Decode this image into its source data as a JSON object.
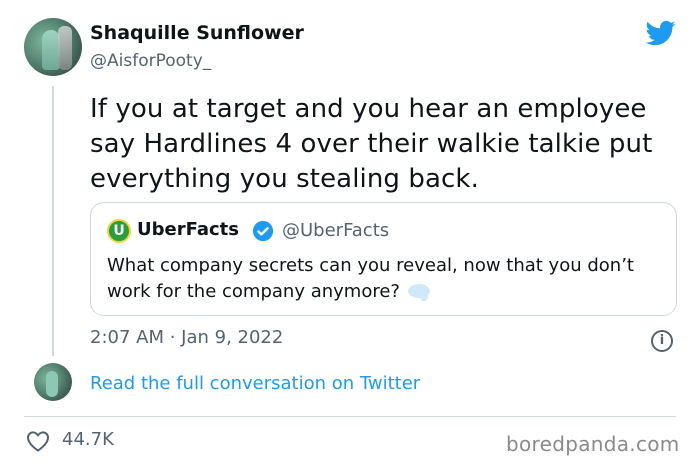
{
  "author": {
    "display_name": "Shaquille Sunflower",
    "handle": "@AisforPooty_"
  },
  "tweet": {
    "text": "If you at target and you hear an employee say Hardlines 4 over their walkie talkie put everything you stealing back.",
    "timestamp": "2:07 AM · Jan 9, 2022",
    "likes": "44.7K"
  },
  "quoted_tweet": {
    "avatar_letter": "U",
    "display_name": "UberFacts",
    "handle": "@UberFacts",
    "text": "What company secrets can you reveal, now that you don’t work for the company anymore?"
  },
  "conversation_link": "Read the full conversation on Twitter",
  "watermark": "boredpanda.com",
  "icons": {
    "brand": "twitter-bird-icon",
    "verified": "verified-badge-icon",
    "info": "info-icon",
    "like": "heart-icon",
    "emoji": "thought-bubble-icon"
  },
  "colors": {
    "accent": "#1d9bf0",
    "text": "#0f1419",
    "secondary": "#536471",
    "border": "#cfd9de"
  }
}
